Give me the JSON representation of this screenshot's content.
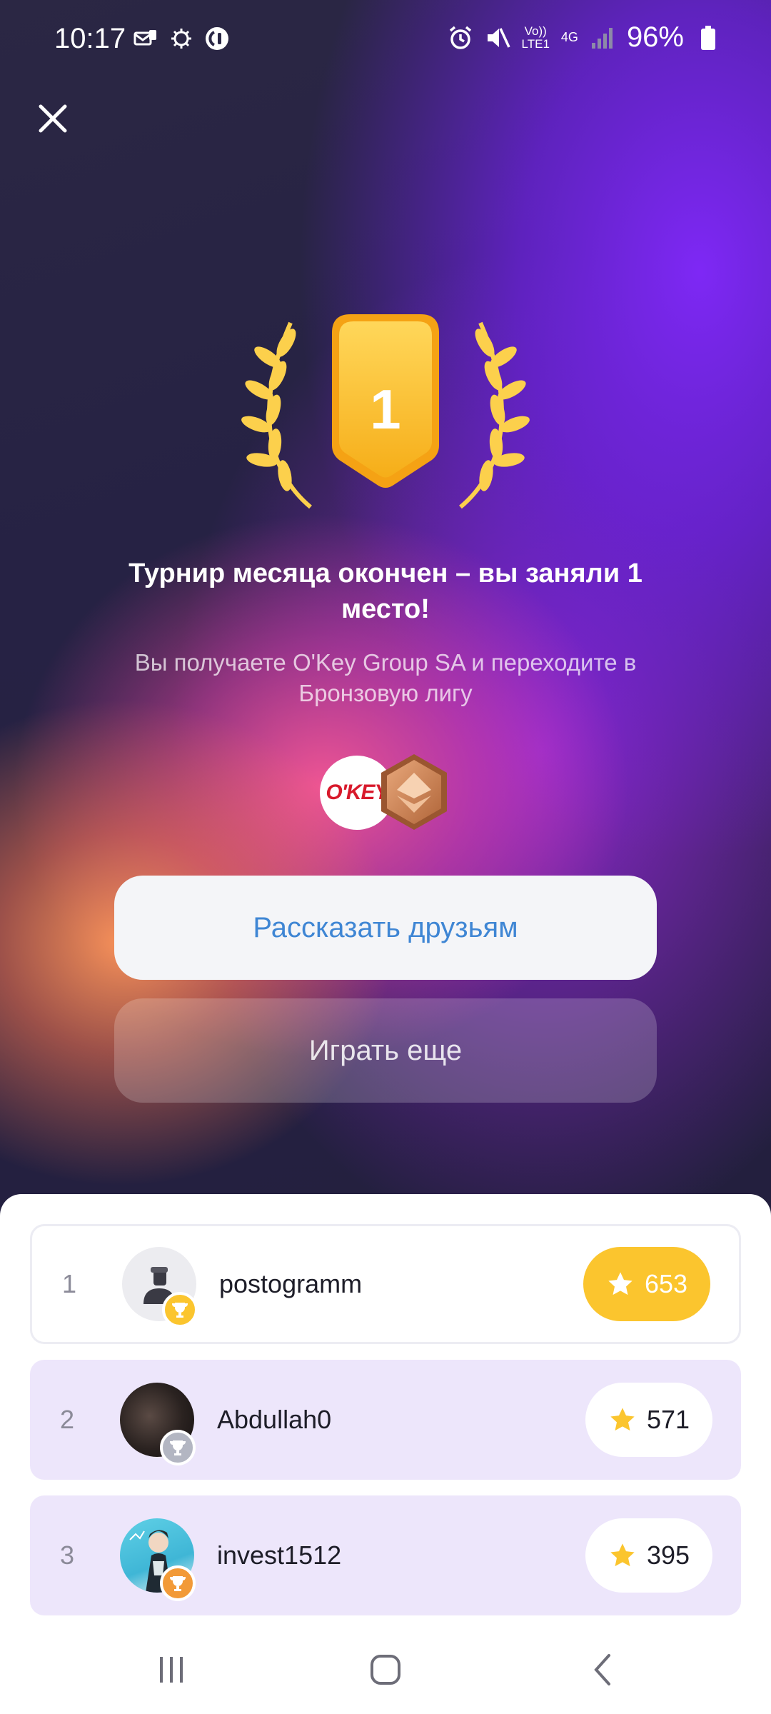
{
  "status_bar": {
    "time": "10:17",
    "battery": "96%",
    "network_label_top": "Vo))",
    "network_label_bottom": "LTE1",
    "network_type": "4G",
    "icons": [
      "mail-icon",
      "bug-icon",
      "circle-icon",
      "alarm-icon",
      "mute-icon",
      "signal-icon",
      "battery-icon"
    ]
  },
  "header": {
    "close_icon": "close-icon"
  },
  "result": {
    "place": "1",
    "title": "Турнир месяца окончен – вы заняли 1 место!",
    "subtitle": "Вы получаете O'Key Group SA и переходите в Бронзовую лигу",
    "reward_logo_text": "O'KEY",
    "league_icon": "bronze-league-icon"
  },
  "buttons": {
    "share": "Рассказать друзьям",
    "play_again": "Играть еще"
  },
  "leaderboard": [
    {
      "rank": "1",
      "username": "postogramm",
      "score": "653",
      "trophy": "gold",
      "highlight": "current-user"
    },
    {
      "rank": "2",
      "username": "Abdullah0",
      "score": "571",
      "trophy": "silver"
    },
    {
      "rank": "3",
      "username": "invest1512",
      "score": "395",
      "trophy": "bronze"
    }
  ],
  "nav": {
    "recent": "recent-apps-icon",
    "home": "home-icon",
    "back": "back-icon"
  },
  "colors": {
    "gold": "#fbc52e",
    "silver": "#b3b6c2",
    "bronze": "#f29a38",
    "row_highlight": "#ede6fb",
    "link_blue": "#3f86d4"
  }
}
